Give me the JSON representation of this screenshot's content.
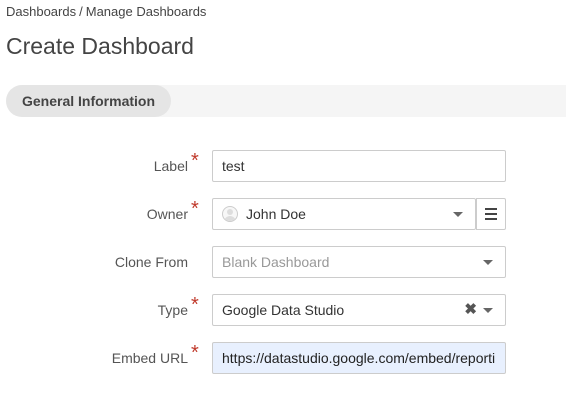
{
  "breadcrumb": {
    "items": [
      "Dashboards",
      "Manage Dashboards"
    ],
    "separator": "/"
  },
  "page": {
    "title": "Create Dashboard"
  },
  "section": {
    "tab_label": "General Information"
  },
  "form": {
    "label": {
      "label": "Label",
      "value": "test",
      "required": true
    },
    "owner": {
      "label": "Owner",
      "value": "John Doe",
      "required": true
    },
    "clone_from": {
      "label": "Clone From",
      "placeholder": "Blank Dashboard",
      "required": false
    },
    "type": {
      "label": "Type",
      "value": "Google Data Studio",
      "required": true
    },
    "embed_url": {
      "label": "Embed URL",
      "value": "https://datastudio.google.com/embed/reporti",
      "required": true
    }
  },
  "icons": {
    "required_marker": "*",
    "clear_glyph": "✖",
    "required_color": "#c0392b",
    "embed_field_background": "#e8f0fe"
  }
}
